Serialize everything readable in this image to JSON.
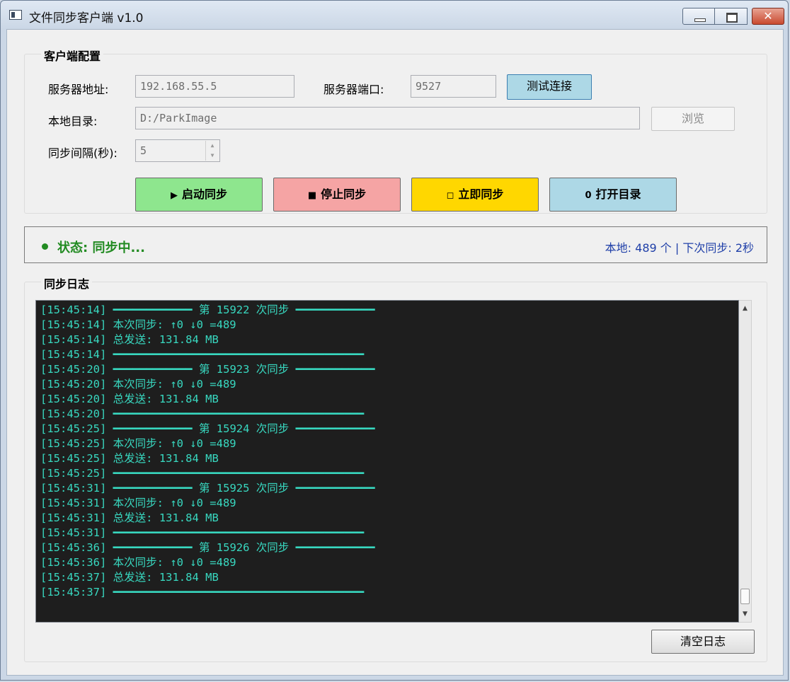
{
  "window": {
    "title": "文件同步客户端 v1.0",
    "close_glyph": "✕"
  },
  "config": {
    "group_title": "客户端配置",
    "server_address_label": "服务器地址:",
    "server_address_value": "192.168.55.5",
    "server_port_label": "服务器端口:",
    "server_port_value": "9527",
    "test_button": "测试连接",
    "local_dir_label": "本地目录:",
    "local_dir_value": "D:/ParkImage",
    "browse_button": "浏览",
    "interval_label": "同步间隔(秒):",
    "interval_value": "5",
    "actions": {
      "start": {
        "icon": "▶",
        "label": "启动同步"
      },
      "stop": {
        "icon": "■",
        "label": "停止同步"
      },
      "now": {
        "icon": "◻",
        "label": "立即同步"
      },
      "open": {
        "icon": "0",
        "label": "打开目录"
      }
    }
  },
  "status": {
    "text": "状态: 同步中...",
    "right": "本地: 489 个 | 下次同步: 2秒",
    "color": "#228b22"
  },
  "log": {
    "group_title": "同步日志",
    "lines": [
      "[15:45:14] ━━━━━━━━━━━━ 第 15922 次同步 ━━━━━━━━━━━━",
      "[15:45:14] 本次同步: ↑0 ↓0 =489",
      "[15:45:14] 总发送: 131.84 MB",
      "[15:45:14] ━━━━━━━━━━━━━━━━━━━━━━━━━━━━━━━━━━━━━━",
      "[15:45:20] ━━━━━━━━━━━━ 第 15923 次同步 ━━━━━━━━━━━━",
      "[15:45:20] 本次同步: ↑0 ↓0 =489",
      "[15:45:20] 总发送: 131.84 MB",
      "[15:45:20] ━━━━━━━━━━━━━━━━━━━━━━━━━━━━━━━━━━━━━━",
      "[15:45:25] ━━━━━━━━━━━━ 第 15924 次同步 ━━━━━━━━━━━━",
      "[15:45:25] 本次同步: ↑0 ↓0 =489",
      "[15:45:25] 总发送: 131.84 MB",
      "[15:45:25] ━━━━━━━━━━━━━━━━━━━━━━━━━━━━━━━━━━━━━━",
      "[15:45:31] ━━━━━━━━━━━━ 第 15925 次同步 ━━━━━━━━━━━━",
      "[15:45:31] 本次同步: ↑0 ↓0 =489",
      "[15:45:31] 总发送: 131.84 MB",
      "[15:45:31] ━━━━━━━━━━━━━━━━━━━━━━━━━━━━━━━━━━━━━━",
      "[15:45:36] ━━━━━━━━━━━━ 第 15926 次同步 ━━━━━━━━━━━━",
      "[15:45:36] 本次同步: ↑0 ↓0 =489",
      "[15:45:37] 总发送: 131.84 MB",
      "[15:45:37] ━━━━━━━━━━━━━━━━━━━━━━━━━━━━━━━━━━━━━━"
    ],
    "clear_button": "清空日志",
    "text_color": "#38d8c0",
    "background": "#1e1e1e"
  }
}
